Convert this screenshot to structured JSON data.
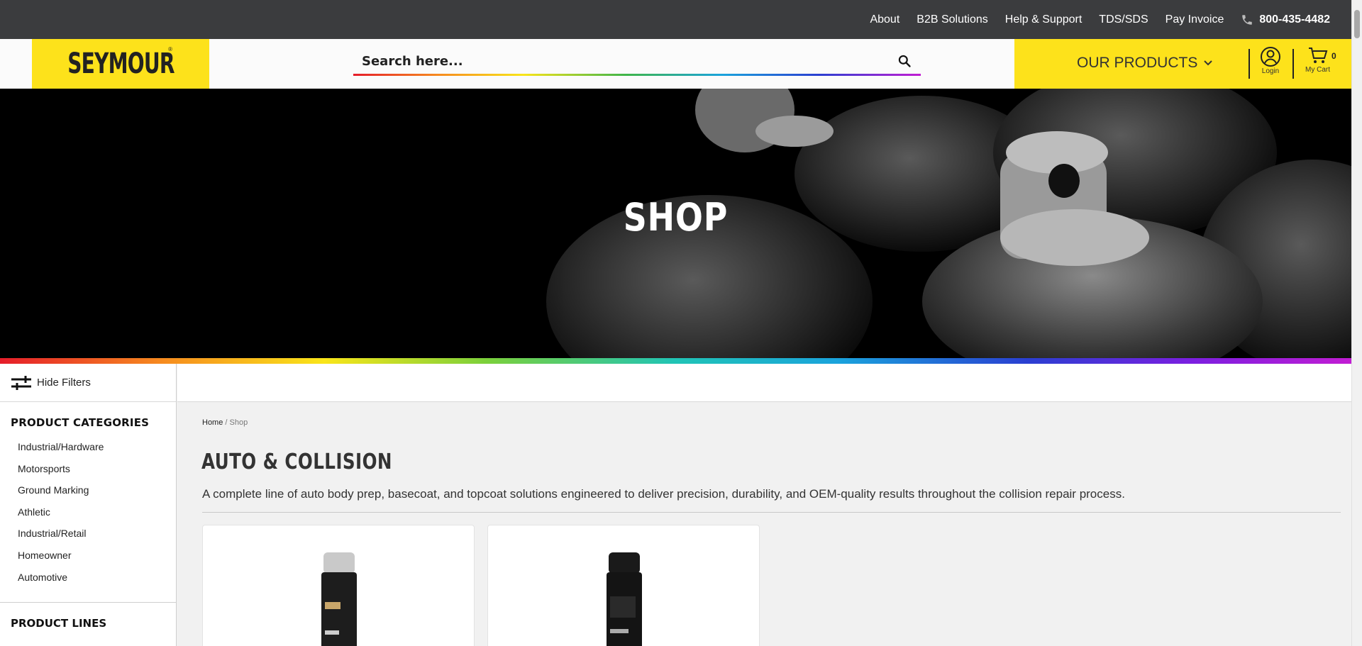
{
  "topbar": {
    "links": [
      "About",
      "B2B Solutions",
      "Help & Support",
      "TDS/SDS",
      "Pay Invoice"
    ],
    "phone": "800-435-4482"
  },
  "header": {
    "logo": "SEYMOUR",
    "search_placeholder": "Search here...",
    "our_products": "OUR PRODUCTS",
    "login_label": "Login",
    "cart_label": "My Cart",
    "cart_count": "0"
  },
  "hero": {
    "title": "SHOP"
  },
  "sidebar": {
    "hide_filters": "Hide Filters",
    "categories_title": "PRODUCT CATEGORIES",
    "categories": [
      "Industrial/Hardware",
      "Motorsports",
      "Ground Marking",
      "Athletic",
      "Industrial/Retail",
      "Homeowner",
      "Automotive"
    ],
    "lines_title": "PRODUCT LINES"
  },
  "main": {
    "breadcrumb_home": "Home",
    "breadcrumb_sep": " / ",
    "breadcrumb_current": "Shop",
    "title": "AUTO & COLLISION",
    "description": "A complete line of auto body prep, basecoat, and topcoat solutions engineered to deliver precision, durability, and OEM-quality results throughout the collision repair process."
  },
  "colors": {
    "brand_yellow": "#fde21b",
    "topbar": "#3b3c3e"
  }
}
